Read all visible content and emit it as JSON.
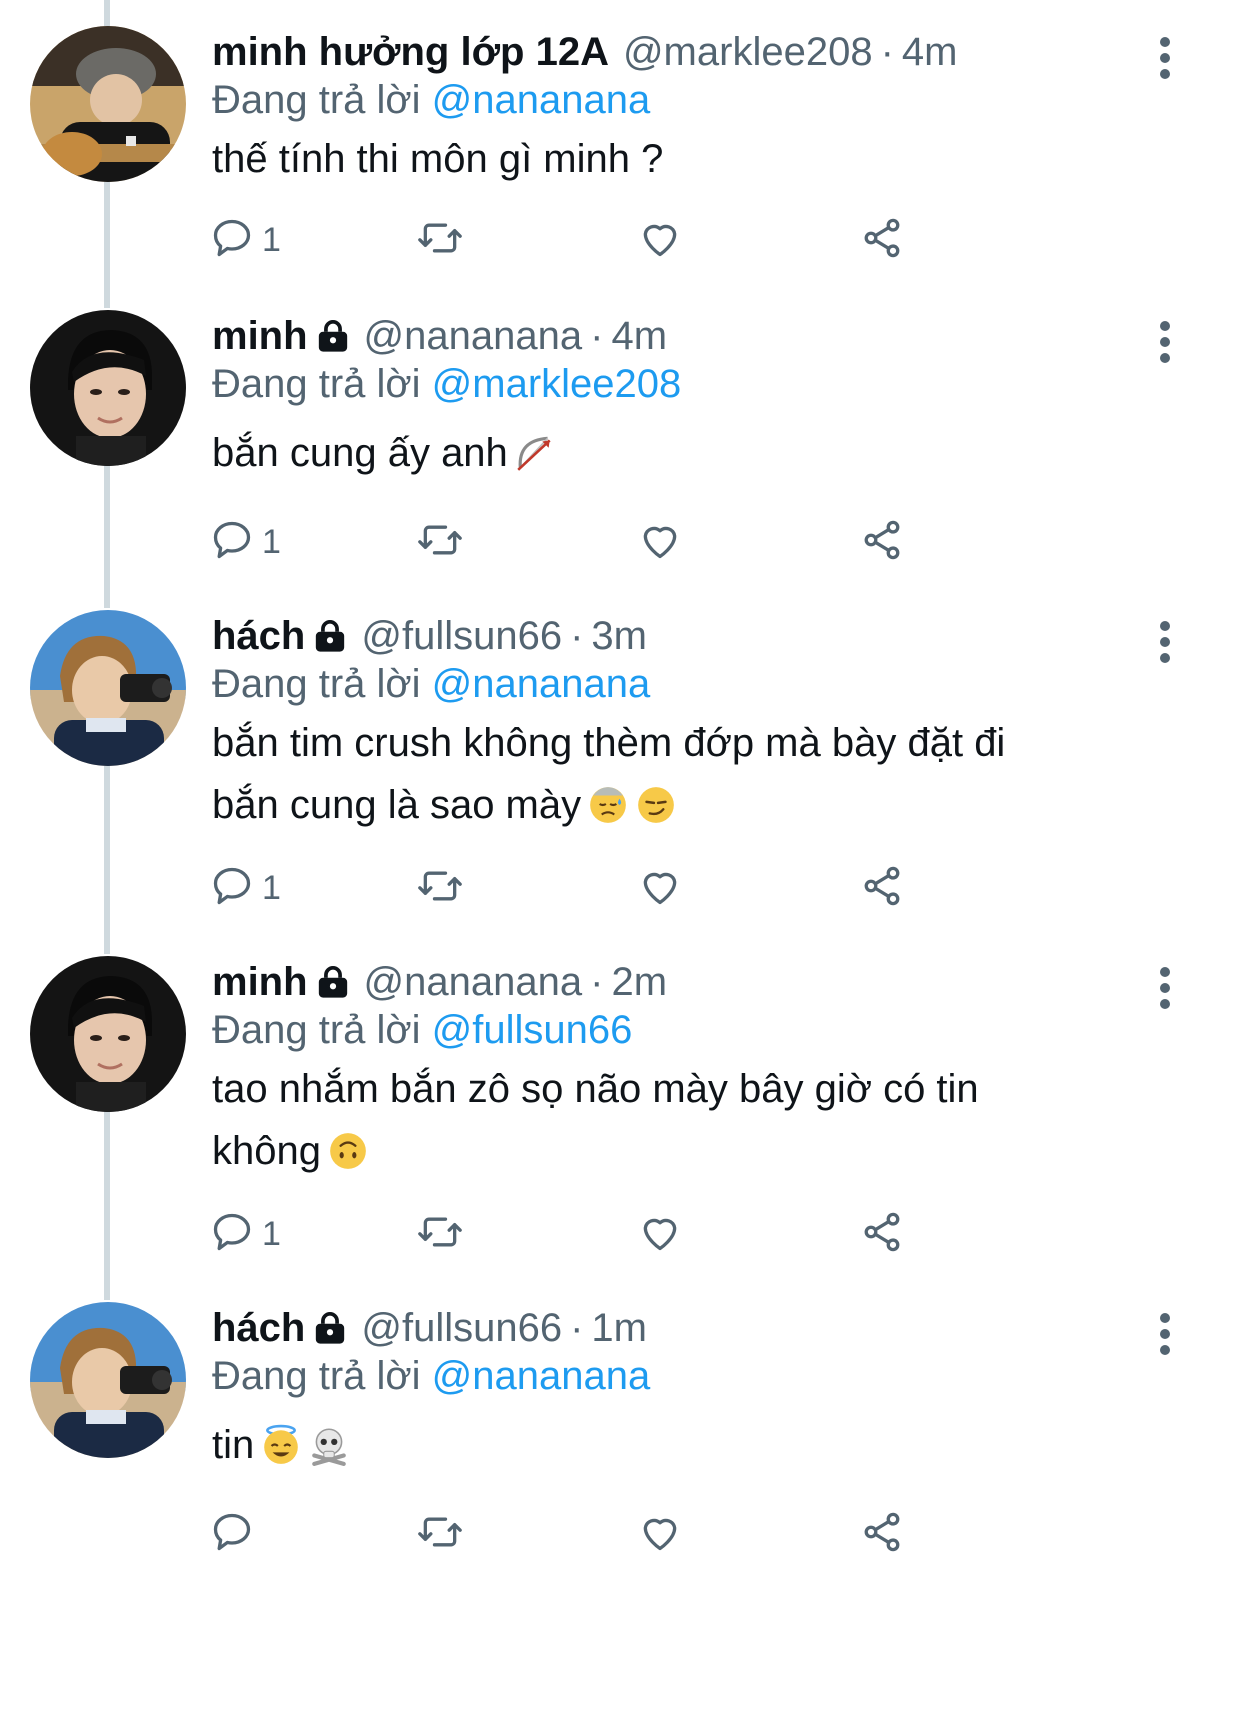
{
  "colors": {
    "mention": "#1d9bf0",
    "muted": "#536471",
    "text": "#0f1419",
    "thread_line": "#cfd9de"
  },
  "tweets": [
    {
      "name": "minh hưởng lớp 12A",
      "locked": false,
      "handle": "@marklee208",
      "dot": "·",
      "time": "4m",
      "reply_prefix": "Đang trả lời",
      "reply_to": "@nananana",
      "text_lines": [
        "thế tính thi môn gì minh ?"
      ],
      "emojis": [],
      "reply_count": "1",
      "avatar": "guitar-avatar"
    },
    {
      "name": "minh",
      "locked": true,
      "handle": "@nananana",
      "dot": "·",
      "time": "4m",
      "reply_prefix": "Đang trả lời",
      "reply_to": "@marklee208",
      "text_lines": [
        "bắn cung ấy anh"
      ],
      "emojis": [
        "bow-and-arrow"
      ],
      "reply_count": "1",
      "avatar": "dark-portrait-avatar"
    },
    {
      "name": "hách",
      "locked": true,
      "handle": "@fullsun66",
      "dot": "·",
      "time": "3m",
      "reply_prefix": "Đang trả lời",
      "reply_to": "@nananana",
      "text_lines": [
        "bắn tim crush không thèm đớp mà bày đặt đi",
        "bắn cung là sao mày"
      ],
      "emojis": [
        "downcast-sweat-face",
        "smirk-face"
      ],
      "reply_count": "1",
      "avatar": "beach-camera-avatar"
    },
    {
      "name": "minh",
      "locked": true,
      "handle": "@nananana",
      "dot": "·",
      "time": "2m",
      "reply_prefix": "Đang trả lời",
      "reply_to": "@fullsun66",
      "text_lines": [
        "tao nhắm bắn zô sọ não mày bây giờ có tin",
        "không"
      ],
      "emojis": [
        "upside-down-face"
      ],
      "reply_count": "1",
      "avatar": "dark-portrait-avatar"
    },
    {
      "name": "hách",
      "locked": true,
      "handle": "@fullsun66",
      "dot": "·",
      "time": "1m",
      "reply_prefix": "Đang trả lời",
      "reply_to": "@nananana",
      "text_lines": [
        "tin"
      ],
      "emojis": [
        "halo-face",
        "skull-and-crossbones"
      ],
      "reply_count": "",
      "avatar": "beach-camera-avatar"
    }
  ]
}
